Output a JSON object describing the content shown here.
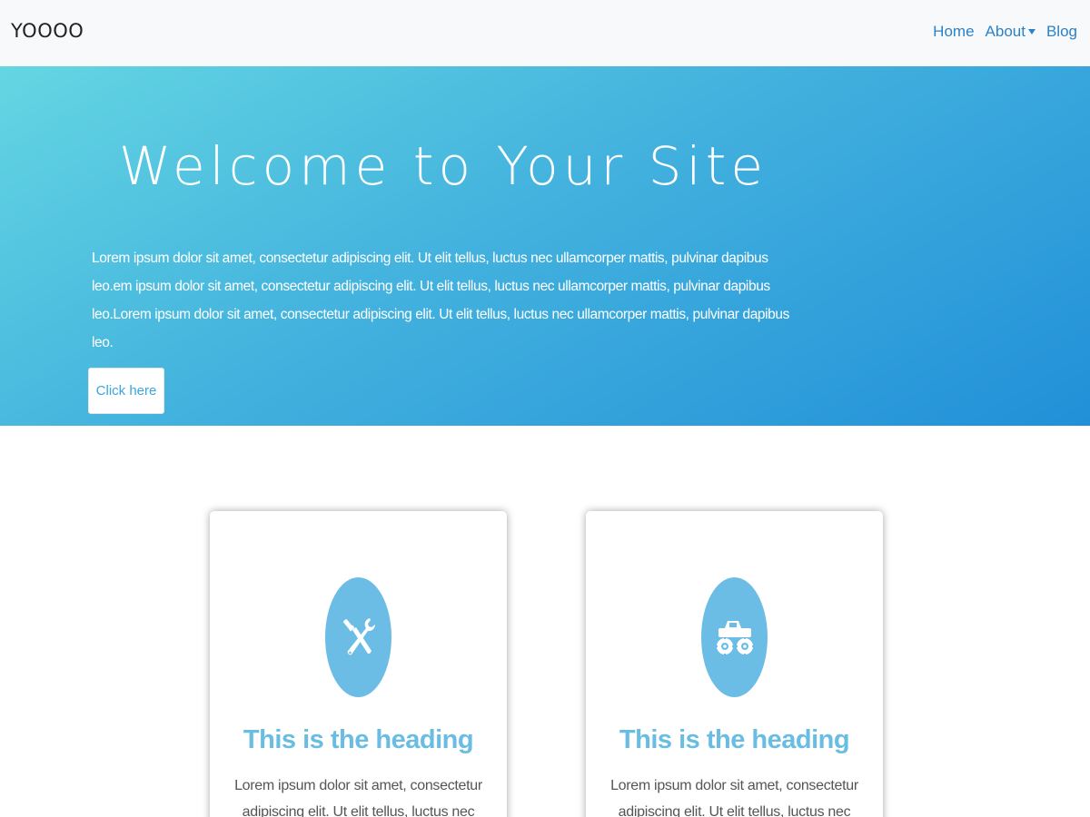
{
  "navbar": {
    "brand": "YOOOO",
    "links": [
      {
        "label": "Home"
      },
      {
        "label": "About",
        "has_dropdown": true
      },
      {
        "label": "Blog"
      }
    ]
  },
  "hero": {
    "title": "Welcome to Your Site",
    "text": "Lorem ipsum dolor sit amet, consectetur adipiscing elit. Ut elit tellus, luctus nec ullamcorper mattis, pulvinar dapibus leo.em ipsum dolor sit amet, consectetur adipiscing elit. Ut elit tellus, luctus nec ullamcorper mattis, pulvinar dapibus leo.Lorem ipsum dolor sit amet, consectetur adipiscing elit. Ut elit tellus, luctus nec ullamcorper mattis, pulvinar dapibus leo.",
    "button_label": "Click here"
  },
  "cards": [
    {
      "icon": "tools-icon",
      "heading": "This is the heading",
      "text": "Lorem ipsum dolor sit amet, consectetur adipiscing elit. Ut elit tellus, luctus nec ullamcorper mattis"
    },
    {
      "icon": "monster-truck-icon",
      "heading": "This is the heading",
      "text": "Lorem ipsum dolor sit amet, consectetur adipiscing elit. Ut elit tellus, luctus nec ullamcorper mattis"
    }
  ],
  "colors": {
    "accent": "#69bde3",
    "link": "#2a82c8",
    "hero_gradient_start": "#64d6e2",
    "hero_gradient_end": "#2190d8",
    "icon_circle": "#6bbde6"
  }
}
